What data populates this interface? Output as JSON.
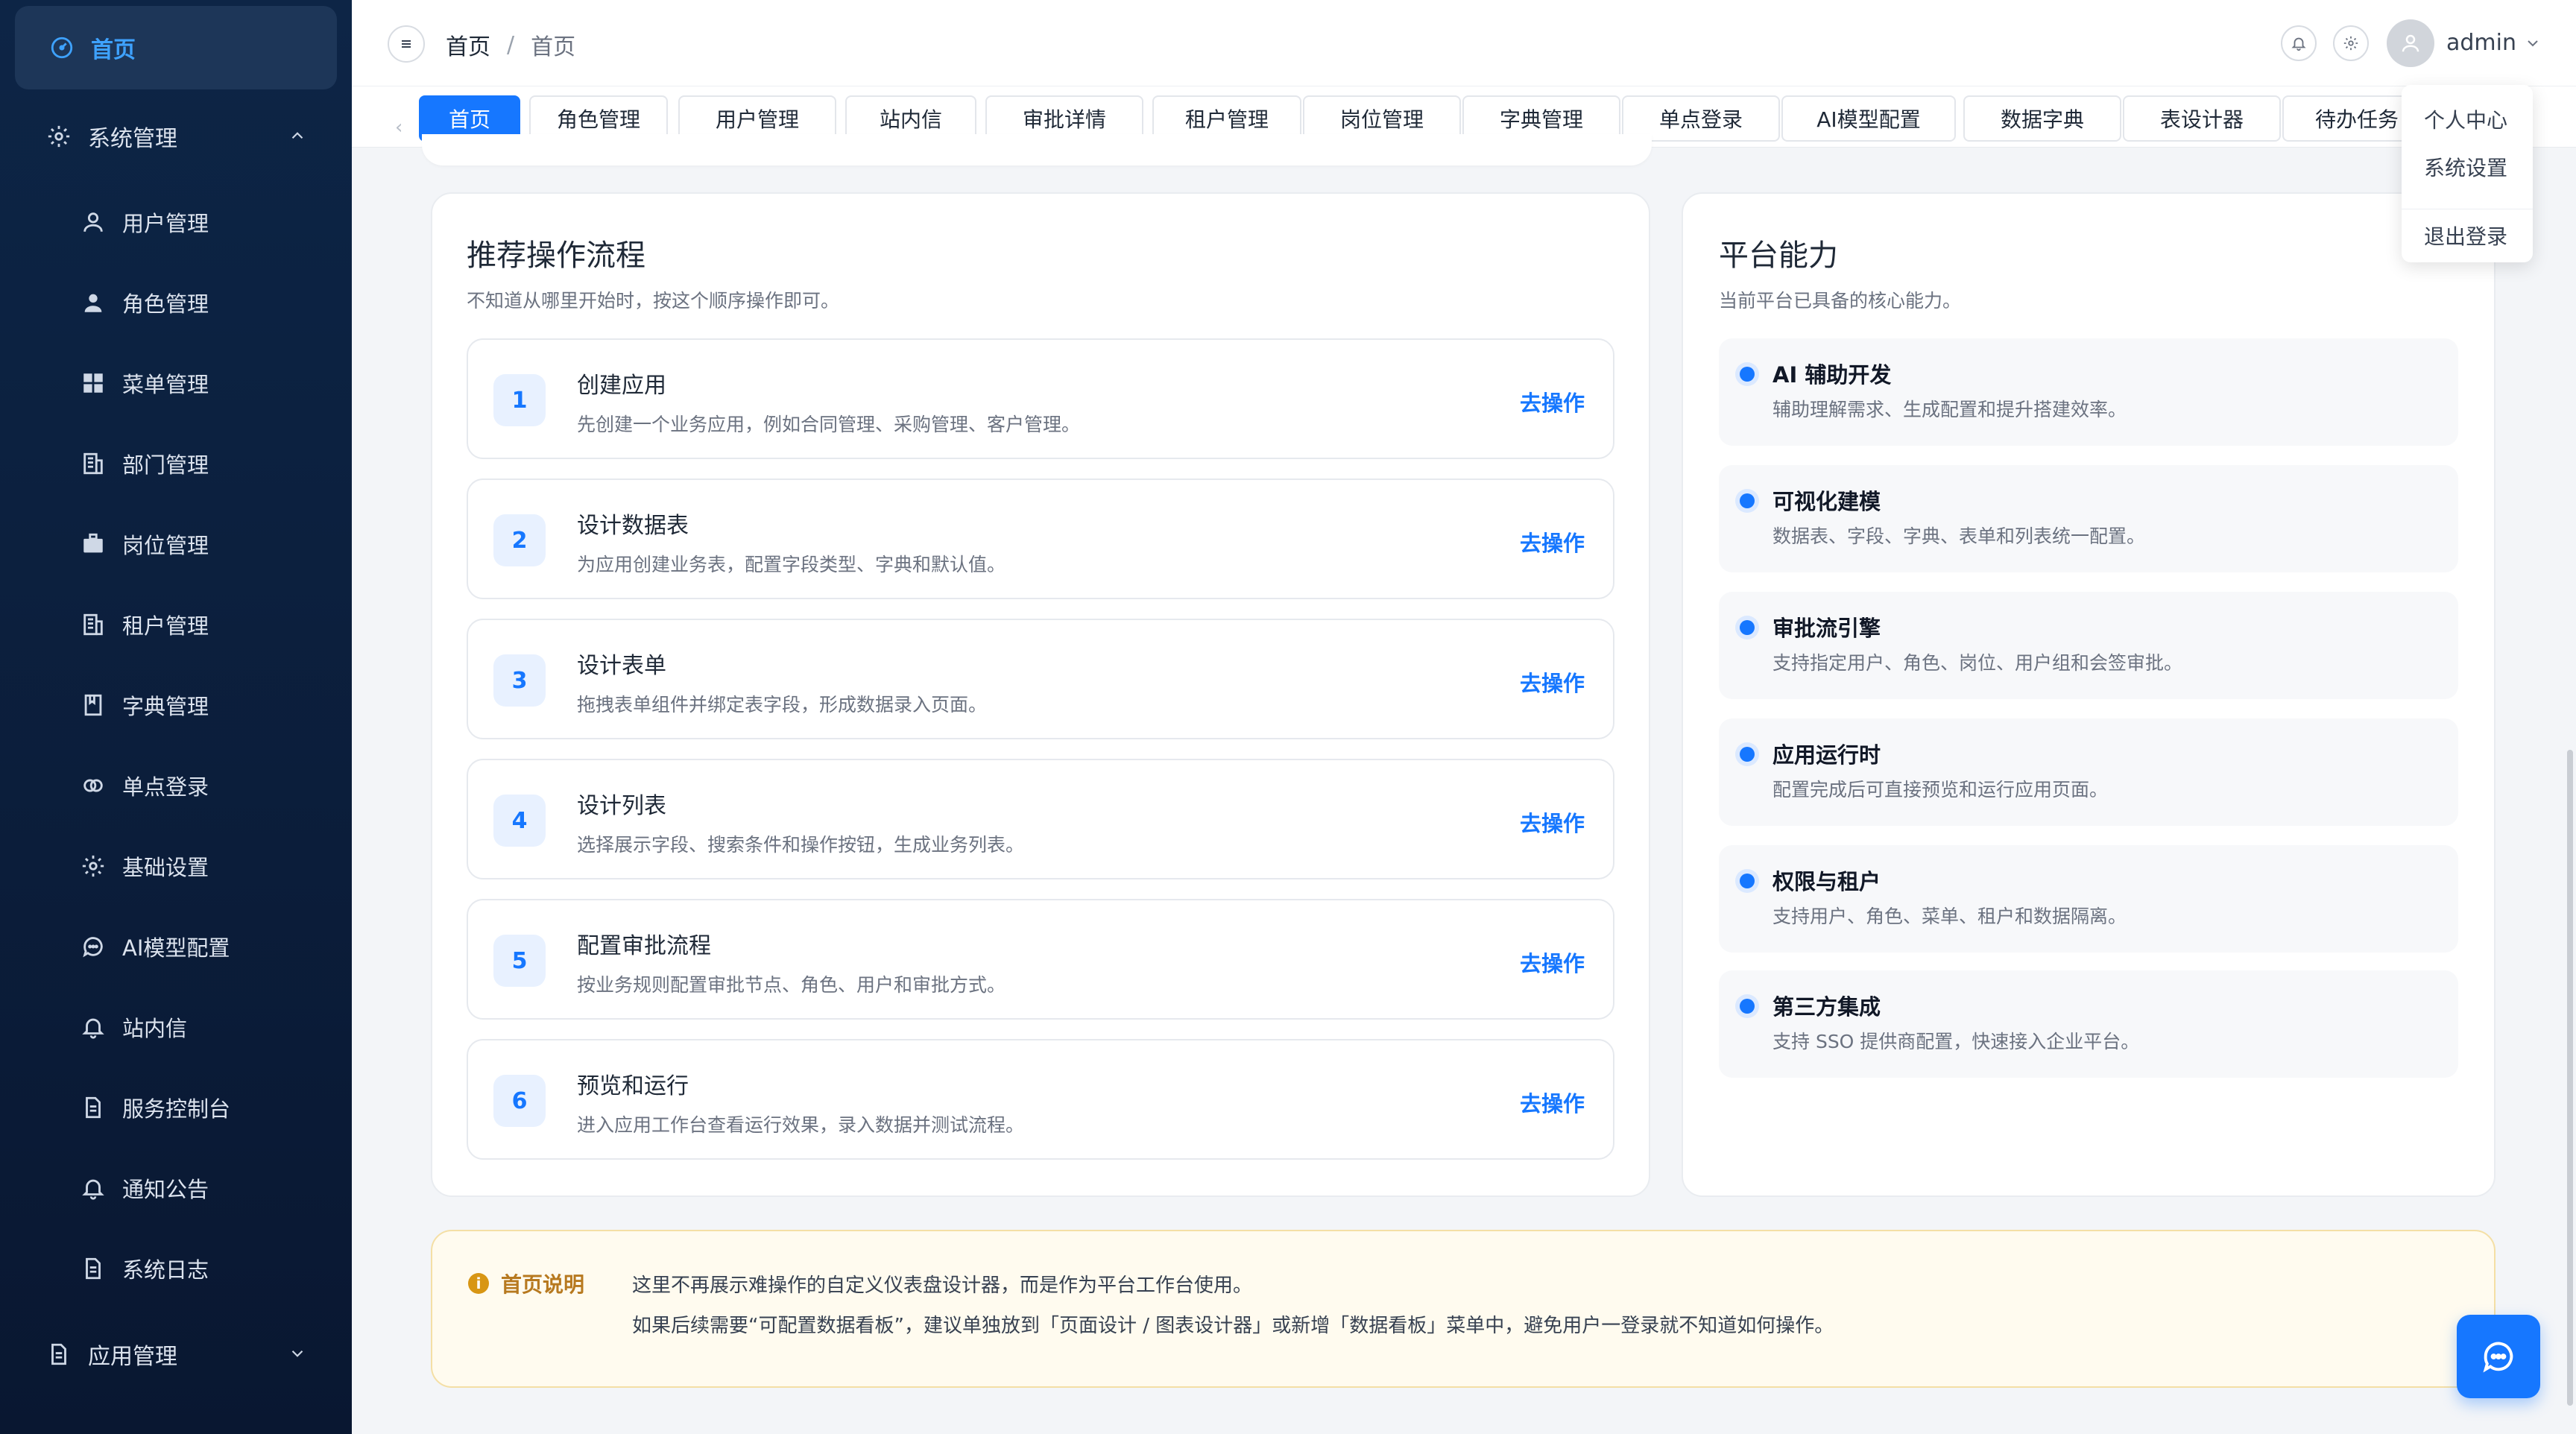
{
  "sidebar": {
    "active": "首页",
    "system_group": "系统管理",
    "items": [
      "用户管理",
      "角色管理",
      "菜单管理",
      "部门管理",
      "岗位管理",
      "租户管理",
      "字典管理",
      "单点登录",
      "基础设置",
      "AI模型配置",
      "站内信",
      "服务控制台",
      "通知公告",
      "系统日志"
    ],
    "app_group": "应用管理"
  },
  "header": {
    "breadcrumb_root": "首页",
    "breadcrumb_sep": "/",
    "breadcrumb_current": "首页",
    "username": "admin"
  },
  "tabs": [
    "首页",
    "角色管理",
    "用户管理",
    "站内信",
    "审批详情",
    "租户管理",
    "岗位管理",
    "字典管理",
    "单点登录",
    "AI模型配置",
    "数据字典",
    "表设计器",
    "待办任务"
  ],
  "dropdown": [
    "个人中心",
    "系统设置",
    "退出登录"
  ],
  "flow": {
    "title": "推荐操作流程",
    "subtitle": "不知道从哪里开始时，按这个顺序操作即可。",
    "action_label": "去操作",
    "steps": [
      {
        "num": "1",
        "title": "创建应用",
        "desc": "先创建一个业务应用，例如合同管理、采购管理、客户管理。"
      },
      {
        "num": "2",
        "title": "设计数据表",
        "desc": "为应用创建业务表，配置字段类型、字典和默认值。"
      },
      {
        "num": "3",
        "title": "设计表单",
        "desc": "拖拽表单组件并绑定表字段，形成数据录入页面。"
      },
      {
        "num": "4",
        "title": "设计列表",
        "desc": "选择展示字段、搜索条件和操作按钮，生成业务列表。"
      },
      {
        "num": "5",
        "title": "配置审批流程",
        "desc": "按业务规则配置审批节点、角色、用户和审批方式。"
      },
      {
        "num": "6",
        "title": "预览和运行",
        "desc": "进入应用工作台查看运行效果，录入数据并测试流程。"
      }
    ]
  },
  "capabilities": {
    "title": "平台能力",
    "subtitle": "当前平台已具备的核心能力。",
    "items": [
      {
        "title": "AI 辅助开发",
        "desc": "辅助理解需求、生成配置和提升搭建效率。"
      },
      {
        "title": "可视化建模",
        "desc": "数据表、字段、字典、表单和列表统一配置。"
      },
      {
        "title": "审批流引擎",
        "desc": "支持指定用户、角色、岗位、用户组和会签审批。"
      },
      {
        "title": "应用运行时",
        "desc": "配置完成后可直接预览和运行应用页面。"
      },
      {
        "title": "权限与租户",
        "desc": "支持用户、角色、菜单、租户和数据隔离。"
      },
      {
        "title": "第三方集成",
        "desc": "支持 SSO 提供商配置，快速接入企业平台。"
      }
    ]
  },
  "notice": {
    "title": "首页说明",
    "line1": "这里不再展示难操作的自定义仪表盘设计器，而是作为平台工作台使用。",
    "line2": "如果后续需要“可配置数据看板”，建议单独放到「页面设计 / 图表设计器」或新增「数据看板」菜单中，避免用户一登录就不知道如何操作。"
  },
  "colors": {
    "primary": "#1677ff",
    "sidebar_bg": "#0b1d3a",
    "notice_bg": "#fffbef"
  }
}
